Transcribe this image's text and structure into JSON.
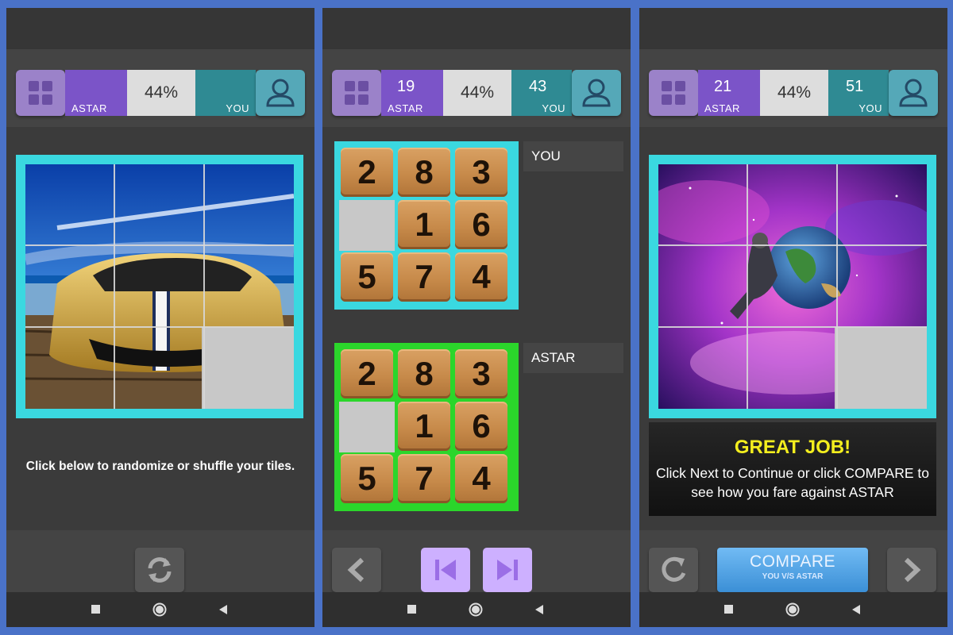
{
  "screens": [
    {
      "hud": {
        "astar_label": "ASTAR",
        "astar_score": "",
        "percent": "44%",
        "you_label": "YOU",
        "you_score": ""
      },
      "instruction": "Click below to randomize or shuffle your tiles.",
      "image": "sports-car-photo",
      "toolbar": [
        "shuffle-icon"
      ]
    },
    {
      "hud": {
        "astar_label": "ASTAR",
        "astar_score": "19",
        "percent": "44%",
        "you_label": "YOU",
        "you_score": "43"
      },
      "boards": [
        {
          "label": "YOU",
          "tiles": [
            "2",
            "8",
            "3",
            "",
            "1",
            "6",
            "5",
            "7",
            "4"
          ]
        },
        {
          "label": "ASTAR",
          "tiles": [
            "2",
            "8",
            "3",
            "",
            "1",
            "6",
            "5",
            "7",
            "4"
          ]
        }
      ],
      "toolbar": [
        "chevron-left-icon",
        "skip-to-start-icon",
        "skip-to-end-icon"
      ]
    },
    {
      "hud": {
        "astar_label": "ASTAR",
        "astar_score": "21",
        "percent": "44%",
        "you_label": "YOU",
        "you_score": "51"
      },
      "image": "astronaut-space-photo",
      "message": {
        "title": "GREAT JOB!",
        "body": "Click Next to Continue or click COMPARE to see how you fare against ASTAR"
      },
      "compare": {
        "label": "COMPARE",
        "sub": "YOU V/S ASTAR"
      },
      "toolbar": [
        "restart-icon",
        "chevron-right-icon"
      ]
    }
  ],
  "colors": {
    "astar": "#7b54c8",
    "you": "#2f8a93",
    "board_border": "#3ad8e0",
    "astar_board_border": "#2bd62b",
    "title_yellow": "#f3ee1e"
  }
}
